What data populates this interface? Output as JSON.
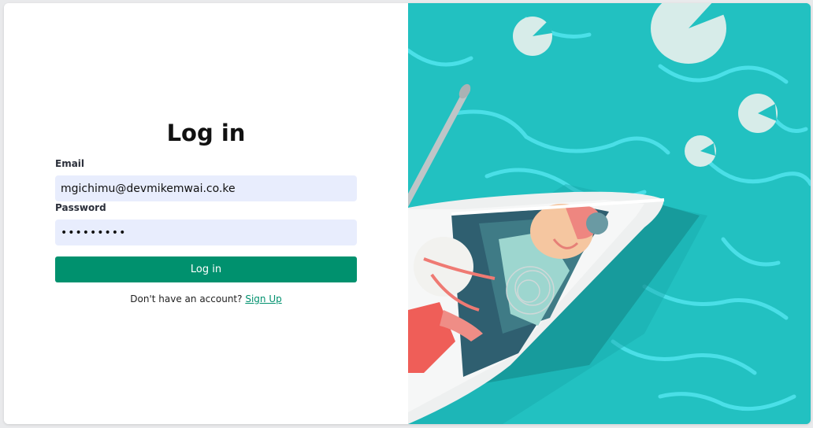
{
  "login": {
    "title": "Log in",
    "email_label": "Email",
    "email_value": "mgichimu@devmikemwai.co.ke",
    "password_label": "Password",
    "password_value": "•••••••••",
    "submit_label": "Log in",
    "signup_prompt": "Don't have an account?",
    "signup_link": "Sign Up"
  },
  "colors": {
    "accent": "#00916e",
    "input_bg": "#e8edfd",
    "water": "#22c1c1"
  },
  "illustration": {
    "icon": "boat-on-water-illustration"
  }
}
